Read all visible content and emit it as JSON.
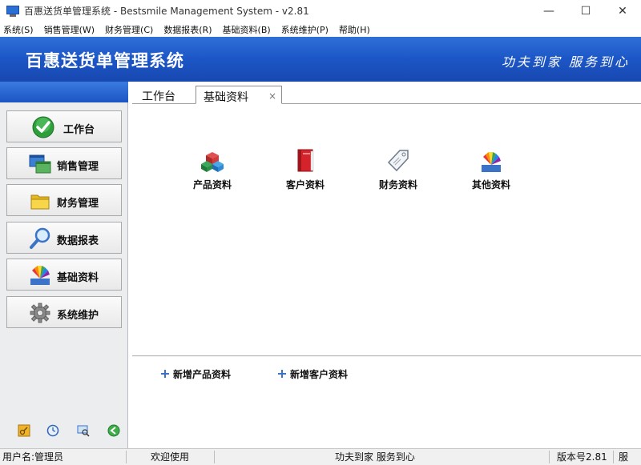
{
  "window": {
    "title": "百惠送货单管理系统 - Bestsmile Management System - v2.81",
    "minimize": "—",
    "maximize": "☐",
    "close": "✕"
  },
  "menu": [
    "系统(S)",
    "销售管理(W)",
    "财务管理(C)",
    "数据报表(R)",
    "基础资料(B)",
    "系统维护(P)",
    "帮助(H)"
  ],
  "banner": {
    "title": "百惠送货单管理系统",
    "slogan": "功夫到家 服务到心"
  },
  "sidebar": {
    "items": [
      {
        "label": "工作台",
        "icon": "check-circle-icon"
      },
      {
        "label": "销售管理",
        "icon": "windows-icon"
      },
      {
        "label": "财务管理",
        "icon": "folder-icon"
      },
      {
        "label": "数据报表",
        "icon": "magnifier-icon"
      },
      {
        "label": "基础资料",
        "icon": "color-fan-icon"
      },
      {
        "label": "系统维护",
        "icon": "gear-icon"
      }
    ],
    "tools": [
      "key-icon",
      "clock-icon",
      "monitor-search-icon",
      "exit-arrow-icon"
    ]
  },
  "tabs": [
    {
      "label": "工作台"
    },
    {
      "label": "基础资料",
      "close": "×"
    }
  ],
  "shortcuts": [
    {
      "label": "产品资料",
      "icon": "cubes-icon"
    },
    {
      "label": "客户资料",
      "icon": "red-book-icon"
    },
    {
      "label": "财务资料",
      "icon": "price-tag-icon"
    },
    {
      "label": "其他资料",
      "icon": "color-fan-icon"
    }
  ],
  "quick_actions": [
    {
      "label": "新增产品资料"
    },
    {
      "label": "新增客户资料"
    }
  ],
  "status": {
    "user": "用户名:管理员",
    "welcome": "欢迎使用",
    "slogan": "功夫到家 服务到心",
    "version": "版本号2.81",
    "tail": "服"
  }
}
